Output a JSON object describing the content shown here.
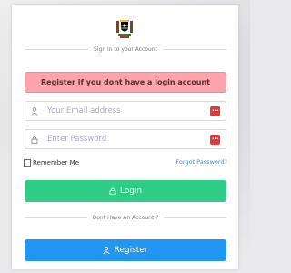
{
  "page": {
    "signin_caption": "Sign in to your Account",
    "alert_text": "Register if you dont have a login account",
    "email_placeholder": "Your Email address",
    "password_placeholder": "Enter Password",
    "remember_label": "Remember Me",
    "forgot_label": "Forgot Password?",
    "login_label": "Login",
    "no_account_caption": "Dont Have An Account ?",
    "register_label": "Register",
    "password_badge": "•••"
  },
  "colors": {
    "alert_bg": "#fda4ad",
    "login_green": "#2ecc85",
    "register_blue": "#2196f3",
    "link_blue": "#3a8fd8",
    "badge_red": "#e03b3b"
  },
  "icons": {
    "crest": "coat-of-arms-icon",
    "email": "user-icon",
    "password": "lock-icon",
    "login": "unlock-icon",
    "register": "user-icon",
    "badge": "password-manager-icon"
  }
}
